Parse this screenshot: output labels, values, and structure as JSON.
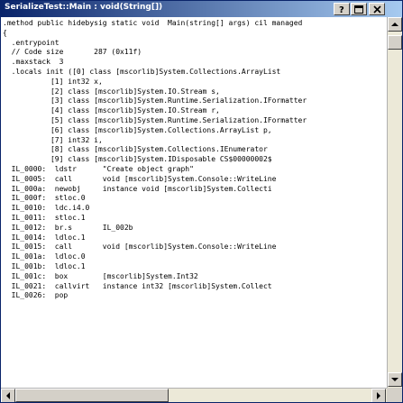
{
  "window": {
    "title": "SerializeTest::Main : void(String[])"
  },
  "title_buttons": [
    {
      "name": "help-button",
      "icon": "help-icon"
    },
    {
      "name": "maximize-button",
      "icon": "maximize-icon"
    },
    {
      "name": "close-button",
      "icon": "close-icon"
    }
  ],
  "code_lines": [
    ".method public hidebysig static void  Main(string[] args) cil managed",
    "{",
    "  .entrypoint",
    "  // Code size       287 (0x11f)",
    "  .maxstack  3",
    "  .locals init ([0] class [mscorlib]System.Collections.ArrayList",
    "           [1] int32 x,",
    "           [2] class [mscorlib]System.IO.Stream s,",
    "           [3] class [mscorlib]System.Runtime.Serialization.IFormatter",
    "           [4] class [mscorlib]System.IO.Stream r,",
    "           [5] class [mscorlib]System.Runtime.Serialization.IFormatter",
    "           [6] class [mscorlib]System.Collections.ArrayList p,",
    "           [7] int32 i,",
    "           [8] class [mscorlib]System.Collections.IEnumerator",
    "           [9] class [mscorlib]System.IDisposable CS$00000002$",
    "  IL_0000:  ldstr      \"Create object graph\"",
    "  IL_0005:  call       void [mscorlib]System.Console::WriteLine",
    "  IL_000a:  newobj     instance void [mscorlib]System.Collecti",
    "  IL_000f:  stloc.0",
    "  IL_0010:  ldc.i4.0",
    "  IL_0011:  stloc.1",
    "  IL_0012:  br.s       IL_002b",
    "  IL_0014:  ldloc.1",
    "  IL_0015:  call       void [mscorlib]System.Console::WriteLine",
    "  IL_001a:  ldloc.0",
    "  IL_001b:  ldloc.1",
    "  IL_001c:  box        [mscorlib]System.Int32",
    "  IL_0021:  callvirt   instance int32 [mscorlib]System.Collect",
    "  IL_0026:  pop"
  ]
}
